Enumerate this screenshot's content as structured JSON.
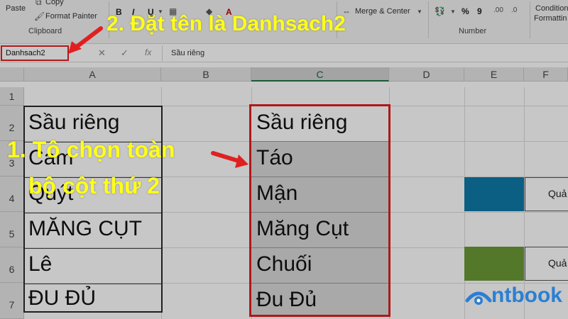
{
  "ribbon": {
    "paste_label": "Paste",
    "copy_label": "Copy",
    "format_painter_label": "Format Painter",
    "clipboard_group": "Clipboard",
    "bold_label": "B",
    "italic_label": "I",
    "underline_label": "U",
    "font_color_label": "A",
    "merge_center_label": "Merge & Center",
    "number_group": "Number",
    "percent_label": "%",
    "comma_label": "9",
    "conditional_label": "Condition",
    "formatting_label": "Formattin"
  },
  "formula_bar": {
    "name_box": "Danhsach2",
    "cancel_icon": "✕",
    "enter_icon": "✓",
    "fx_label": "fx",
    "formula_value": "Sầu riêng"
  },
  "sheet": {
    "columns": [
      "A",
      "B",
      "C",
      "D",
      "E",
      "F"
    ],
    "rows": [
      "1",
      "2",
      "3",
      "4",
      "5",
      "6",
      "7"
    ],
    "col_a": [
      "Sầu riêng",
      "Cam",
      "Quýt",
      "MĂNG CỤT",
      "Lê",
      "ĐU ĐỦ"
    ],
    "col_c": [
      "Sầu riêng",
      "Táo",
      "Mận",
      "Măng Cụt",
      "Chuối",
      "Đu Đủ"
    ],
    "f4": "Quả",
    "f6": "Quả",
    "colors": {
      "e4_fill": "#0f7aa8",
      "e6_fill": "#6b9a36",
      "selection_border": "#e02020",
      "selected_fill": "#d9d9d9"
    }
  },
  "annotations": {
    "step2": "2. Đặt tên là Danhsach2",
    "step1_line1": "1. Tô chọn toàn",
    "step1_line2": "bộ cột thứ 2",
    "color": "#ffff1a"
  },
  "logo": {
    "text": "ntbook"
  }
}
